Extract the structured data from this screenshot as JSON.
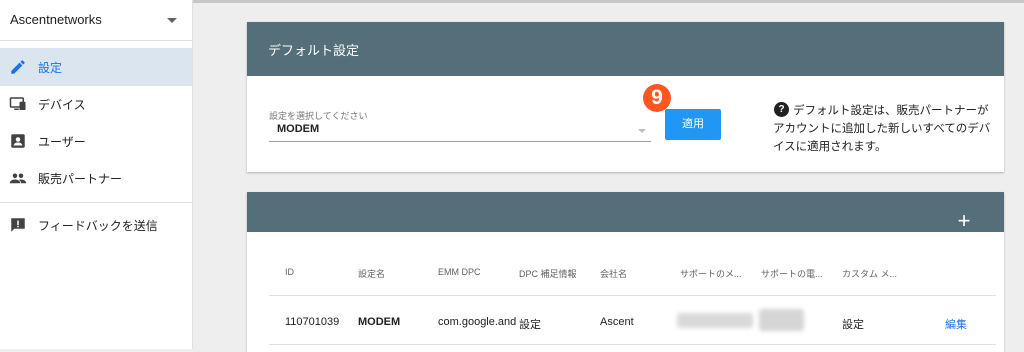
{
  "sidebar": {
    "org_name": "Ascentnetworks",
    "items": [
      {
        "label": "設定",
        "icon": "pencil-icon",
        "active": true
      },
      {
        "label": "デバイス",
        "icon": "devices-icon",
        "active": false
      },
      {
        "label": "ユーザー",
        "icon": "user-icon",
        "active": false
      },
      {
        "label": "販売パートナー",
        "icon": "people-icon",
        "active": false
      },
      {
        "label": "フィードバックを送信",
        "icon": "feedback-icon",
        "active": false
      }
    ]
  },
  "default_settings": {
    "title": "デフォルト設定",
    "select_label": "設定を選択してください",
    "selected_value": "MODEM",
    "apply_label": "適用",
    "step_badge": "9",
    "help_icon": "?",
    "help_text": "デフォルト設定は、販売パートナーがアカウントに追加した新しいすべてのデバイスに適用されます。"
  },
  "config_table": {
    "add_label": "+",
    "columns": [
      "ID",
      "設定名",
      "EMM DPC",
      "DPC 補足情報",
      "会社名",
      "サポートのメ...",
      "サポートの電...",
      "カスタム メ..."
    ],
    "rows": [
      {
        "id": "110701039",
        "name": "MODEM",
        "emm_dpc": "com.google.and",
        "dpc_extra": "設定",
        "company": "Ascent",
        "custom_message": "設定",
        "edit_label": "編集"
      }
    ]
  },
  "colors": {
    "card_header": "#546e7a",
    "primary_button": "#2196f3",
    "badge": "#ff5722",
    "active_nav": "#dbe5ef",
    "link": "#1a73e8"
  }
}
